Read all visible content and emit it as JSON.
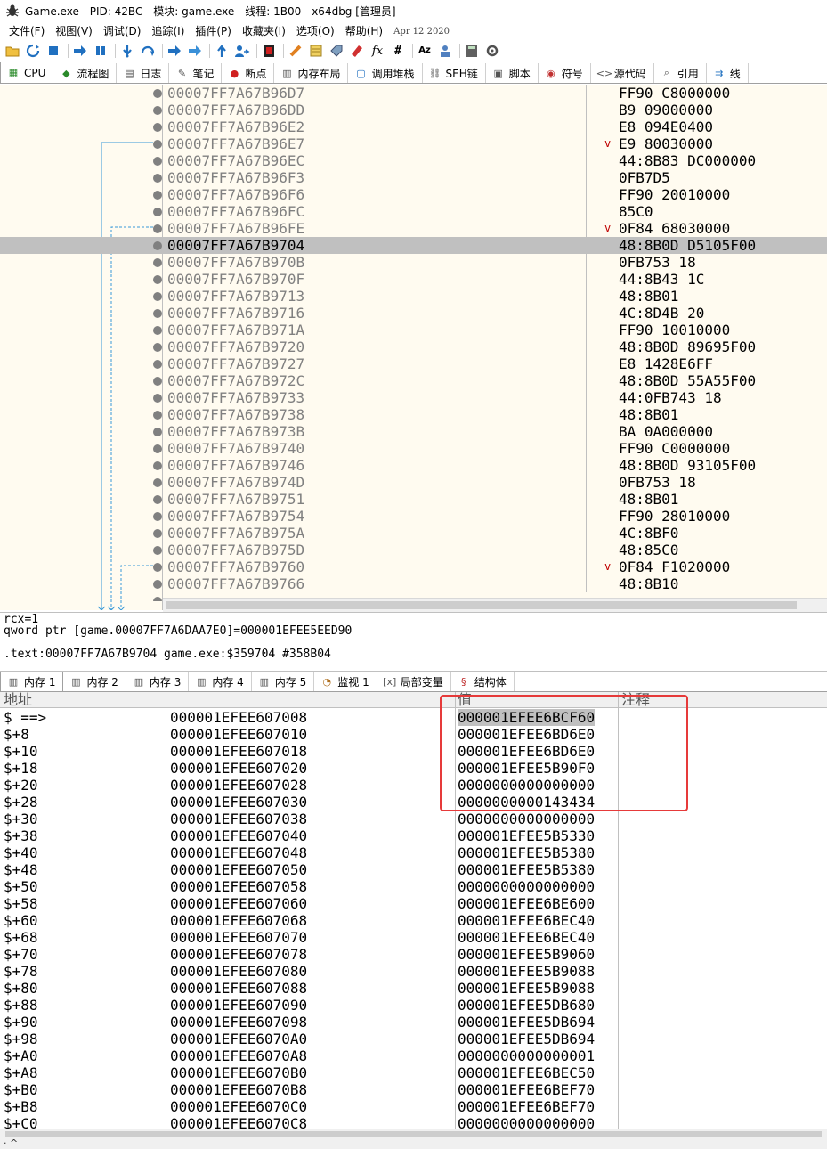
{
  "window": {
    "title": "Game.exe - PID: 42BC - 模块: game.exe - 线程: 1B00 - x64dbg [管理员]",
    "app_icon": "bug-icon"
  },
  "menubar": {
    "items": [
      "文件(F)",
      "视图(V)",
      "调试(D)",
      "追踪(I)",
      "插件(P)",
      "收藏夹(I)",
      "选项(O)",
      "帮助(H)"
    ],
    "date": "Apr 12 2020"
  },
  "toolbar": {
    "texts": {
      "fx": "fx",
      "hash": "#",
      "az": "Az"
    }
  },
  "tabs": [
    {
      "label": "CPU",
      "icon": "cpu-icon",
      "active": true
    },
    {
      "label": "流程图",
      "icon": "graph-icon"
    },
    {
      "label": "日志",
      "icon": "log-icon"
    },
    {
      "label": "笔记",
      "icon": "notes-icon"
    },
    {
      "label": "断点",
      "icon": "breakpoint-icon"
    },
    {
      "label": "内存布局",
      "icon": "memory-map-icon"
    },
    {
      "label": "调用堆栈",
      "icon": "callstack-icon"
    },
    {
      "label": "SEH链",
      "icon": "seh-icon"
    },
    {
      "label": "脚本",
      "icon": "script-icon"
    },
    {
      "label": "符号",
      "icon": "symbols-icon"
    },
    {
      "label": "源代码",
      "icon": "source-icon"
    },
    {
      "label": "引用",
      "icon": "references-icon"
    },
    {
      "label": "线",
      "icon": "threads-icon"
    }
  ],
  "disasm": {
    "selected_index": 9,
    "rows": [
      {
        "addr": "00007FF7A67B96D7",
        "bytes": "FF90 C8000000",
        "mark": ""
      },
      {
        "addr": "00007FF7A67B96DD",
        "bytes": "B9 09000000",
        "mark": ""
      },
      {
        "addr": "00007FF7A67B96E2",
        "bytes": "E8 094E0400",
        "mark": ""
      },
      {
        "addr": "00007FF7A67B96E7",
        "bytes": "E9 80030000",
        "mark": "v"
      },
      {
        "addr": "00007FF7A67B96EC",
        "bytes": "44:8B83 DC000000",
        "mark": ""
      },
      {
        "addr": "00007FF7A67B96F3",
        "bytes": "0FB7D5",
        "mark": ""
      },
      {
        "addr": "00007FF7A67B96F6",
        "bytes": "FF90 20010000",
        "mark": ""
      },
      {
        "addr": "00007FF7A67B96FC",
        "bytes": "85C0",
        "mark": ""
      },
      {
        "addr": "00007FF7A67B96FE",
        "bytes": "0F84 68030000",
        "mark": "v"
      },
      {
        "addr": "00007FF7A67B9704",
        "bytes": "48:8B0D D5105F00",
        "mark": ""
      },
      {
        "addr": "00007FF7A67B970B",
        "bytes": "0FB753 18",
        "mark": ""
      },
      {
        "addr": "00007FF7A67B970F",
        "bytes": "44:8B43 1C",
        "mark": ""
      },
      {
        "addr": "00007FF7A67B9713",
        "bytes": "48:8B01",
        "mark": ""
      },
      {
        "addr": "00007FF7A67B9716",
        "bytes": "4C:8D4B 20",
        "mark": ""
      },
      {
        "addr": "00007FF7A67B971A",
        "bytes": "FF90 10010000",
        "mark": ""
      },
      {
        "addr": "00007FF7A67B9720",
        "bytes": "48:8B0D 89695F00",
        "mark": ""
      },
      {
        "addr": "00007FF7A67B9727",
        "bytes": "E8 1428E6FF",
        "mark": ""
      },
      {
        "addr": "00007FF7A67B972C",
        "bytes": "48:8B0D 55A55F00",
        "mark": ""
      },
      {
        "addr": "00007FF7A67B9733",
        "bytes": "44:0FB743 18",
        "mark": ""
      },
      {
        "addr": "00007FF7A67B9738",
        "bytes": "48:8B01",
        "mark": ""
      },
      {
        "addr": "00007FF7A67B973B",
        "bytes": "BA 0A000000",
        "mark": ""
      },
      {
        "addr": "00007FF7A67B9740",
        "bytes": "FF90 C0000000",
        "mark": ""
      },
      {
        "addr": "00007FF7A67B9746",
        "bytes": "48:8B0D 93105F00",
        "mark": ""
      },
      {
        "addr": "00007FF7A67B974D",
        "bytes": "0FB753 18",
        "mark": ""
      },
      {
        "addr": "00007FF7A67B9751",
        "bytes": "48:8B01",
        "mark": ""
      },
      {
        "addr": "00007FF7A67B9754",
        "bytes": "FF90 28010000",
        "mark": ""
      },
      {
        "addr": "00007FF7A67B975A",
        "bytes": "4C:8BF0",
        "mark": ""
      },
      {
        "addr": "00007FF7A67B975D",
        "bytes": "48:85C0",
        "mark": ""
      },
      {
        "addr": "00007FF7A67B9760",
        "bytes": "0F84 F1020000",
        "mark": "v"
      },
      {
        "addr": "00007FF7A67B9766",
        "bytes": "48:8B10",
        "mark": ""
      }
    ]
  },
  "info": {
    "line1": "rcx=1",
    "line2": "qword ptr [game.00007FF7A6DAA7E0]=000001EFEE5EED90",
    "line3": ".text:00007FF7A67B9704 game.exe:$359704 #358B04"
  },
  "memtabs": [
    {
      "label": "内存 1",
      "icon": "memory-icon",
      "active": true
    },
    {
      "label": "内存 2",
      "icon": "memory-icon"
    },
    {
      "label": "内存 3",
      "icon": "memory-icon"
    },
    {
      "label": "内存 4",
      "icon": "memory-icon"
    },
    {
      "label": "内存 5",
      "icon": "memory-icon"
    },
    {
      "label": "监视 1",
      "icon": "watch-icon"
    },
    {
      "label": "局部变量",
      "icon": "locals-icon"
    },
    {
      "label": "结构体",
      "icon": "struct-icon"
    }
  ],
  "memview": {
    "headers": {
      "address": "地址",
      "value": "值",
      "comment": "注释"
    },
    "rows": [
      {
        "offset": "$ ==>",
        "addr": "000001EFEE607008",
        "value": "000001EFEE6BCF60",
        "hl": true
      },
      {
        "offset": "$+8",
        "addr": "000001EFEE607010",
        "value": "000001EFEE6BD6E0"
      },
      {
        "offset": "$+10",
        "addr": "000001EFEE607018",
        "value": "000001EFEE6BD6E0"
      },
      {
        "offset": "$+18",
        "addr": "000001EFEE607020",
        "value": "000001EFEE5B90F0"
      },
      {
        "offset": "$+20",
        "addr": "000001EFEE607028",
        "value": "0000000000000000"
      },
      {
        "offset": "$+28",
        "addr": "000001EFEE607030",
        "value": "0000000000143434"
      },
      {
        "offset": "$+30",
        "addr": "000001EFEE607038",
        "value": "0000000000000000"
      },
      {
        "offset": "$+38",
        "addr": "000001EFEE607040",
        "value": "000001EFEE5B5330"
      },
      {
        "offset": "$+40",
        "addr": "000001EFEE607048",
        "value": "000001EFEE5B5380"
      },
      {
        "offset": "$+48",
        "addr": "000001EFEE607050",
        "value": "000001EFEE5B5380"
      },
      {
        "offset": "$+50",
        "addr": "000001EFEE607058",
        "value": "0000000000000000"
      },
      {
        "offset": "$+58",
        "addr": "000001EFEE607060",
        "value": "000001EFEE6BE600"
      },
      {
        "offset": "$+60",
        "addr": "000001EFEE607068",
        "value": "000001EFEE6BEC40"
      },
      {
        "offset": "$+68",
        "addr": "000001EFEE607070",
        "value": "000001EFEE6BEC40"
      },
      {
        "offset": "$+70",
        "addr": "000001EFEE607078",
        "value": "000001EFEE5B9060"
      },
      {
        "offset": "$+78",
        "addr": "000001EFEE607080",
        "value": "000001EFEE5B9088"
      },
      {
        "offset": "$+80",
        "addr": "000001EFEE607088",
        "value": "000001EFEE5B9088"
      },
      {
        "offset": "$+88",
        "addr": "000001EFEE607090",
        "value": "000001EFEE5DB680"
      },
      {
        "offset": "$+90",
        "addr": "000001EFEE607098",
        "value": "000001EFEE5DB694"
      },
      {
        "offset": "$+98",
        "addr": "000001EFEE6070A0",
        "value": "000001EFEE5DB694"
      },
      {
        "offset": "$+A0",
        "addr": "000001EFEE6070A8",
        "value": "0000000000000001"
      },
      {
        "offset": "$+A8",
        "addr": "000001EFEE6070B0",
        "value": "000001EFEE6BEC50"
      },
      {
        "offset": "$+B0",
        "addr": "000001EFEE6070B8",
        "value": "000001EFEE6BEF70"
      },
      {
        "offset": "$+B8",
        "addr": "000001EFEE6070C0",
        "value": "000001EFEE6BEF70"
      },
      {
        "offset": "$+C0",
        "addr": "000001EFEE6070C8",
        "value": "0000000000000000"
      }
    ]
  },
  "statusbar": {
    "text": "· ^"
  },
  "colors": {
    "disasm_bg": "#fffbf0",
    "selection": "#c0c0c0",
    "annotation_box": "#e63a3a",
    "address_gray": "#808080",
    "jump_arrow": "#c00000"
  }
}
